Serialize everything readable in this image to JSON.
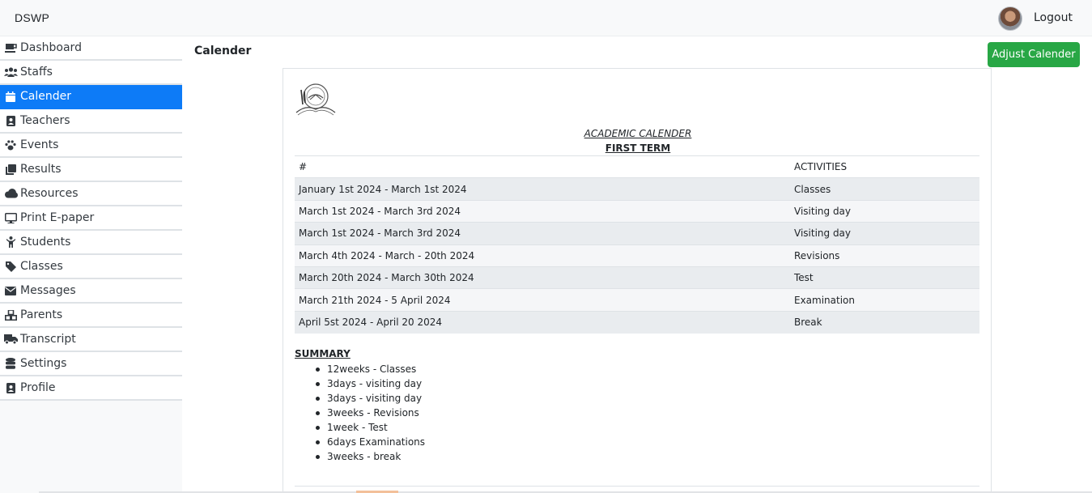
{
  "app": {
    "brand": "DSWP"
  },
  "header": {
    "logout_label": "Logout"
  },
  "sidebar": {
    "items": [
      {
        "label": "Dashboard",
        "icon": "coffee-icon"
      },
      {
        "label": "Staffs",
        "icon": "users-icon"
      },
      {
        "label": "Calender",
        "icon": "calendar-icon",
        "active": true
      },
      {
        "label": "Teachers",
        "icon": "id-badge-icon"
      },
      {
        "label": "Events",
        "icon": "paw-icon"
      },
      {
        "label": "Results",
        "icon": "clone-icon"
      },
      {
        "label": "Resources",
        "icon": "cloud-icon"
      },
      {
        "label": "Print E-paper",
        "icon": "desktop-icon"
      },
      {
        "label": "Students",
        "icon": "child-icon"
      },
      {
        "label": "Classes",
        "icon": "tag-icon"
      },
      {
        "label": "Messages",
        "icon": "envelope-icon"
      },
      {
        "label": "Parents",
        "icon": "cubes-icon"
      },
      {
        "label": "Transcript",
        "icon": "truck-icon"
      },
      {
        "label": "Settings",
        "icon": "database-icon"
      },
      {
        "label": "Profile",
        "icon": "id-badge-icon"
      }
    ]
  },
  "main": {
    "title": "Calender",
    "adjust_button": "Adjust Calender",
    "doc_title": "ACADEMIC CALENDER",
    "term": "FIRST TERM",
    "table": {
      "headers": [
        "#",
        "ACTIVITIES"
      ],
      "rows": [
        [
          "January 1st 2024 - March 1st 2024",
          "Classes"
        ],
        [
          "March 1st 2024 - March 3rd 2024",
          "Visiting day"
        ],
        [
          "March 1st 2024 - March 3rd 2024",
          "Visiting day"
        ],
        [
          "March 4th 2024 - March - 20th 2024",
          "Revisions"
        ],
        [
          "March 20th 2024 - March 30th 2024",
          "Test"
        ],
        [
          "March 21th 2024 - 5 April 2024",
          "Examination"
        ],
        [
          "April 5st 2024 - April 20 2024",
          "Break"
        ]
      ]
    },
    "summary_title": "SUMMARY",
    "summary": [
      "12weeks - Classes",
      "3days - visiting day",
      "3days - visiting day",
      "3weeks - Revisions",
      "1week - Test",
      "6days Examinations",
      "3weeks - break"
    ]
  },
  "colors": {
    "active": "#0d7bf7",
    "button": "#28a745"
  }
}
